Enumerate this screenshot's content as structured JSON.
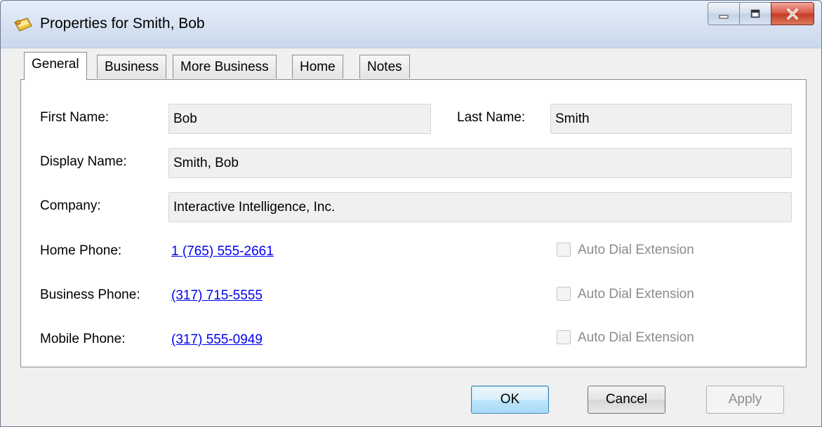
{
  "window": {
    "title": "Properties for Smith, Bob"
  },
  "icons": {
    "app": "contact-card-icon",
    "minimize": "minimize-icon",
    "maximize": "maximize-icon",
    "close": "close-icon"
  },
  "tabs": [
    {
      "label": "General",
      "active": true
    },
    {
      "label": "Business",
      "active": false
    },
    {
      "label": "More Business",
      "active": false
    },
    {
      "label": "Home",
      "active": false
    },
    {
      "label": "Notes",
      "active": false
    }
  ],
  "general": {
    "first_name_label": "First Name:",
    "first_name_value": "Bob",
    "last_name_label": "Last Name:",
    "last_name_value": "Smith",
    "display_name_label": "Display Name:",
    "display_name_value": "Smith, Bob",
    "company_label": "Company:",
    "company_value": "Interactive Intelligence, Inc.",
    "home_phone_label": "Home Phone:",
    "home_phone_value": "1 (765) 555-2661",
    "business_phone_label": "Business Phone:",
    "business_phone_value": "(317) 715-5555",
    "mobile_phone_label": "Mobile Phone:",
    "mobile_phone_value": "(317) 555-0949",
    "auto_dial_label": "Auto Dial Extension"
  },
  "buttons": {
    "ok": "OK",
    "cancel": "Cancel",
    "apply": "Apply"
  },
  "colors": {
    "link": "#0000ee",
    "close_button": "#c23b25",
    "disabled_text": "#8b8b8b"
  }
}
